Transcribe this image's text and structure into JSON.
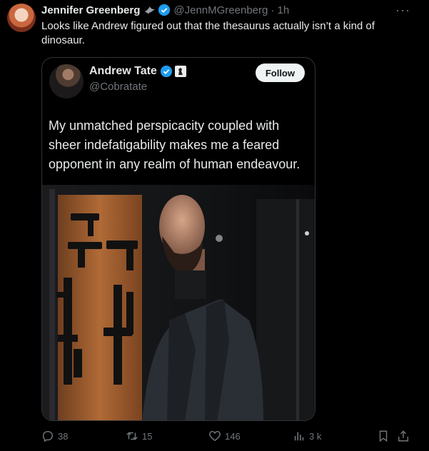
{
  "tweet": {
    "author_name": "Jennifer Greenberg",
    "author_handle": "@JennMGreenberg",
    "time": "· 1h",
    "text": "Looks like Andrew figured out that the thesaurus actually isn’t a kind of dinosaur.",
    "more": "···"
  },
  "quoted": {
    "author_name": "Andrew Tate",
    "author_handle": "@Cobratate",
    "follow_label": "Follow",
    "text": "My unmatched perspicacity coupled with sheer indefatigability makes me a feared opponent in any realm of human endeavour."
  },
  "actions": {
    "replies": "38",
    "reposts": "15",
    "likes": "146",
    "views": "3 k"
  },
  "colors": {
    "background": "#000000",
    "text": "#e7e9ea",
    "muted": "#71767b",
    "verified": "#1d9bf0"
  }
}
